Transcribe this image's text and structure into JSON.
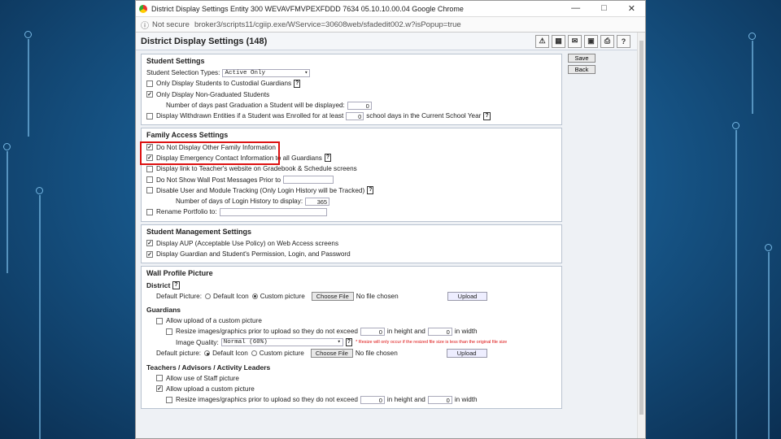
{
  "window": {
    "title": "District Display Settings   Entity 300   WEVAVFMVPEXFDDD   7634   05.10.10.00.04   Google Chrome",
    "minimize": "—",
    "maximize": "□",
    "close": "✕"
  },
  "urlbar": {
    "security": "Not secure",
    "url": "broker3/scripts11/cgiip.exe/WService=30608web/sfadedit002.w?isPopup=true"
  },
  "page": {
    "title": "District Display Settings (148)",
    "tools": [
      "⚠",
      "▦",
      "✉",
      "▣",
      "⎙",
      "?"
    ],
    "save": "Save",
    "back": "Back"
  },
  "student": {
    "heading": "Student Settings",
    "sel_label": "Student Selection Types:",
    "sel_value": "Active Only",
    "r1": "Only Display Students to Custodial Guardians",
    "r2": "Only Display Non-Graduated Students",
    "r3": "Number of days past Graduation a Student will be displayed:",
    "r3_val": "0",
    "r4a": "Display Withdrawn Entities if a Student was Enrolled for at least",
    "r4_val": "0",
    "r4b": "school days in the Current School Year"
  },
  "family": {
    "heading": "Family Access Settings",
    "r1": "Do Not Display Other Family Information",
    "r2": "Display Emergency Contact Information to all Guardians",
    "r3": "Display link to Teacher's website on Gradebook & Schedule screens",
    "r4": "Do Not Show Wall Post Messages Prior to",
    "r5": "Disable User and Module Tracking (Only Login History will be Tracked)",
    "r6": "Number of days of Login History to display:",
    "r6_val": "365",
    "r7": "Rename Portfolio to:"
  },
  "mgmt": {
    "heading": "Student Management Settings",
    "r1": "Display AUP (Acceptable Use Policy) on Web Access screens",
    "r2": "Display Guardian and Student's Permission, Login, and Password"
  },
  "wall": {
    "heading": "Wall Profile Picture",
    "district": "District",
    "default_pic": "Default Picture:",
    "default_icon": "Default Icon",
    "custom": "Custom picture",
    "choose": "Choose File",
    "nofile": "No file chosen",
    "upload": "Upload",
    "guardians": "Guardians",
    "allow_upload": "Allow upload of a custom picture",
    "resize": "Resize images/graphics prior to upload so they do not exceed",
    "h_val": "0",
    "h_label": "in height and",
    "w_val": "0",
    "w_label": "in width",
    "quality": "Image Quality:",
    "quality_val": "Normal (60%)",
    "note": "* Resize will only occur if the resized file size is less than the original file size",
    "default_pic2": "Default picture:",
    "tal": "Teachers / Advisors / Activity Leaders",
    "staff": "Allow use of Staff picture",
    "allow2": "Allow upload a custom picture"
  },
  "q": "?"
}
